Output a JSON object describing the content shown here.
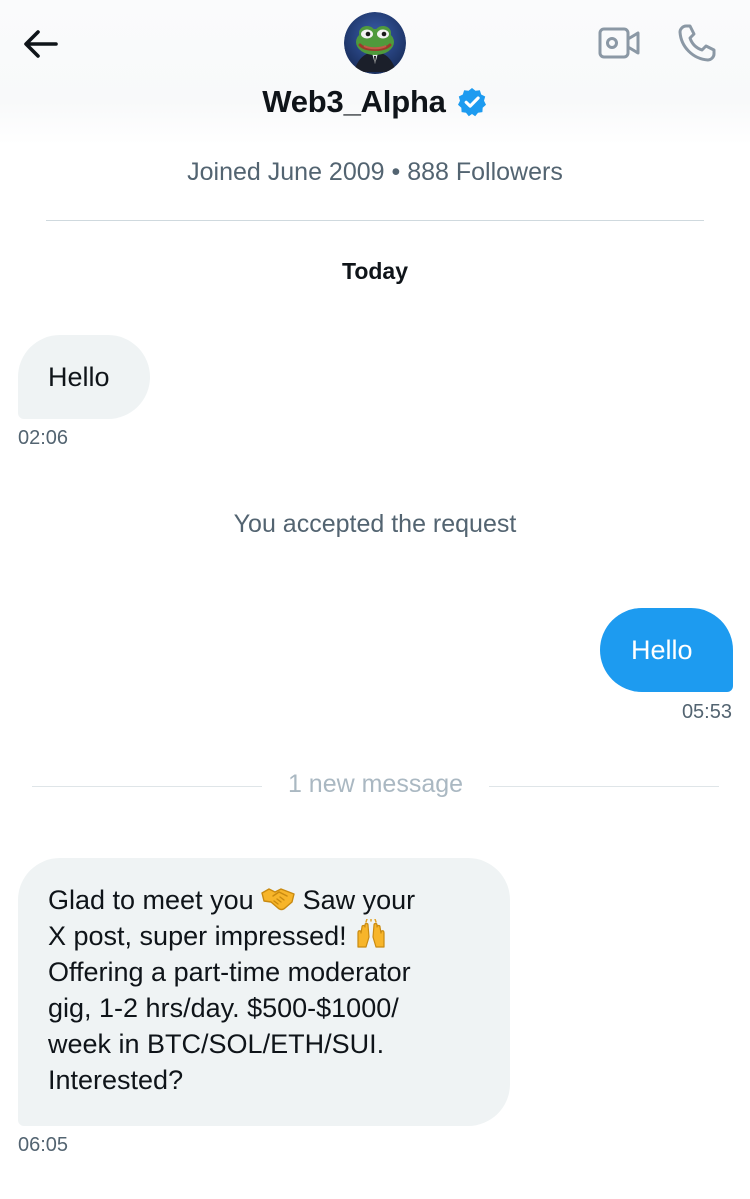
{
  "header": {
    "display_name": "Web3_Alpha",
    "verified": true,
    "meta": "Joined June 2009 • 888 Followers",
    "icons": [
      "back-arrow-icon",
      "video-call-icon",
      "phone-icon",
      "verified-badge-icon"
    ]
  },
  "date_separator": "Today",
  "messages": [
    {
      "direction": "incoming",
      "text": "Hello",
      "time": "02:06"
    },
    {
      "direction": "outgoing",
      "text": "Hello",
      "time": "05:53"
    },
    {
      "direction": "incoming",
      "text_parts": [
        "Glad to meet you ",
        " Saw your\nX post, super impressed! ",
        "\nOffering a part-time moderator\ngig, 1-2 hrs/day. $500-$1000/\nweek in BTC/SOL/ETH/SUI.\nInterested?"
      ],
      "emojis": [
        "handshake-emoji",
        "raising-hands-emoji"
      ],
      "time": "06:05"
    }
  ],
  "system_notice": "You accepted the request",
  "new_message_divider": "1 new message",
  "colors": {
    "accent": "#1d9bf0",
    "incoming_bubble": "#eff3f4",
    "secondary_text": "#536471"
  }
}
